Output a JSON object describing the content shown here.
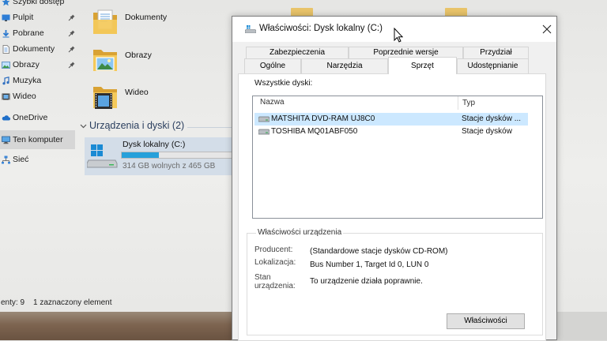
{
  "colors": {
    "accent": "#26a0da",
    "selection": "#cce8ff",
    "drive_tile": "#d3dde8",
    "folder": "#e9c46a"
  },
  "explorer": {
    "sidebar": {
      "items": [
        {
          "label": "Szybki dostęp",
          "icon": "star-icon"
        },
        {
          "label": "Pulpit",
          "icon": "desktop-icon",
          "pinned": true
        },
        {
          "label": "Pobrane",
          "icon": "download-icon",
          "pinned": true
        },
        {
          "label": "Dokumenty",
          "icon": "documents-icon",
          "pinned": true
        },
        {
          "label": "Obrazy",
          "icon": "pictures-icon",
          "pinned": true
        },
        {
          "label": "Muzyka",
          "icon": "music-icon"
        },
        {
          "label": "Wideo",
          "icon": "videos-icon"
        },
        {
          "label": "OneDrive",
          "icon": "onedrive-icon"
        },
        {
          "label": "Ten komputer",
          "icon": "this-pc-icon",
          "selected": true
        },
        {
          "label": "Sieć",
          "icon": "network-icon"
        }
      ]
    },
    "folders": [
      {
        "label": "Dokumenty",
        "icon": "documents-folder-icon"
      },
      {
        "label": "Obrazy",
        "icon": "pictures-folder-icon"
      },
      {
        "label": "Wideo",
        "icon": "videos-folder-icon"
      }
    ],
    "devices_header": "Urządzenia i dyski (2)",
    "drive": {
      "label": "Dysk lokalny (C:)",
      "free_space": "314 GB wolnych z 465 GB",
      "used_fraction": 0.32,
      "icon": "windows-drive-icon"
    },
    "status_bar": {
      "item_count": "enty: 9",
      "selection": "1 zaznaczony element"
    }
  },
  "dialog": {
    "title": "Właściwości: Dysk lokalny (C:)",
    "tabs_back": [
      "Zabezpieczenia",
      "Poprzednie wersje",
      "Przydział"
    ],
    "tabs_front": [
      "Ogólne",
      "Narzędzia",
      "Sprzęt",
      "Udostępnianie"
    ],
    "active_tab": "Sprzęt",
    "disks_label": "Wszystkie dyski:",
    "columns": [
      "Nazwa",
      "Typ"
    ],
    "disks": [
      {
        "name": "MATSHITA DVD-RAM UJ8C0",
        "type": "Stacje dysków ...",
        "selected": true
      },
      {
        "name": "TOSHIBA MQ01ABF050",
        "type": "Stacje dysków"
      }
    ],
    "device_properties": {
      "group_label": "Właściwości urządzenia",
      "rows": [
        {
          "label": "Producent:",
          "value": "(Standardowe stacje dysków CD-ROM)"
        },
        {
          "label": "Lokalizacja:",
          "value": "Bus Number 1, Target Id 0, LUN 0"
        },
        {
          "label": "Stan urządzenia:",
          "value": "To urządzenie działa poprawnie."
        }
      ]
    },
    "properties_button": "Właściwości"
  }
}
